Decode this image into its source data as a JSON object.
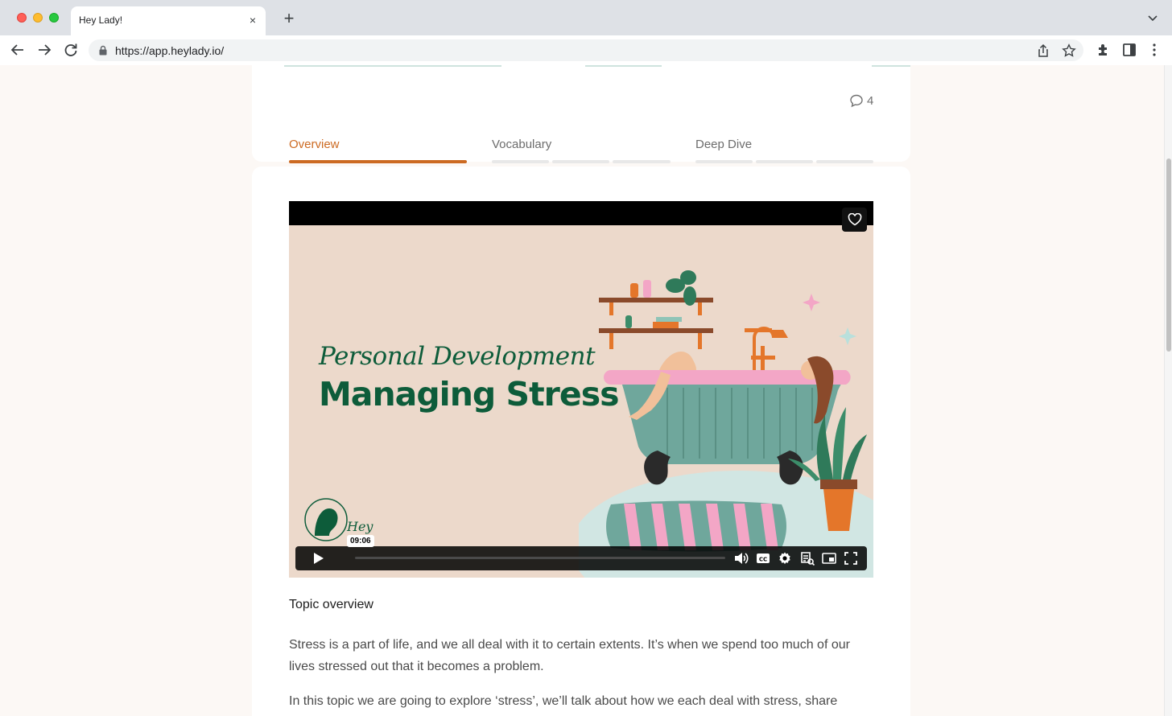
{
  "browser": {
    "tab_title": "Hey Lady!",
    "tab_close_glyph": "×",
    "new_tab_glyph": "+",
    "url": "https://app.heylady.io/"
  },
  "topic": {
    "comment_count": "4",
    "tabs": [
      {
        "label": "Overview",
        "active": true
      },
      {
        "label": "Vocabulary",
        "active": false
      },
      {
        "label": "Deep Dive",
        "active": false
      }
    ]
  },
  "video": {
    "script_title": "Personal Development",
    "main_title": "Managing Stress",
    "logo_text": "Hey Lady!",
    "hover_time": "09:06",
    "progress_fraction": 0.0,
    "icons": [
      "play-icon",
      "volume-icon",
      "captions-icon",
      "settings-icon",
      "transcript-icon",
      "picture-in-picture-icon",
      "fullscreen-icon",
      "heart-icon"
    ]
  },
  "overview": {
    "heading": "Topic overview",
    "paragraph_1": "Stress is a part of life, and we all deal with it to certain extents. It’s when we spend too much of our lives stressed out that it becomes a problem.",
    "paragraph_2": "In this topic we are going to explore ‘stress’, we’ll talk about how we each deal with stress, share"
  },
  "colors": {
    "accent": "#cc6a22",
    "brand_green": "#0d5c3a",
    "page_background": "#fcf8f5",
    "video_background": "#ecd9cb"
  }
}
